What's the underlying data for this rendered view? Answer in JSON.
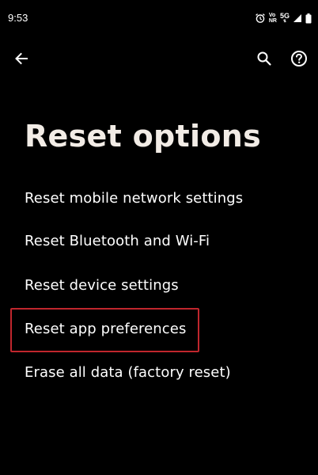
{
  "status_bar": {
    "time": "9:53",
    "volte_line1": "Vo",
    "volte_line2": "NR",
    "network_label": "5G",
    "network_sub": "⇅"
  },
  "toolbar": {
    "back_icon": "arrow-back-icon",
    "search_icon": "search-icon",
    "help_icon": "help-icon"
  },
  "page": {
    "title": "Reset options"
  },
  "options": [
    {
      "label": "Reset mobile network settings"
    },
    {
      "label": "Reset Bluetooth and Wi-Fi"
    },
    {
      "label": "Reset device settings"
    },
    {
      "label": "Reset app preferences"
    },
    {
      "label": "Erase all data (factory reset)"
    }
  ],
  "colors": {
    "background": "#000000",
    "title": "#f2ece6",
    "text": "#ffffff",
    "highlight": "#c0262d"
  }
}
